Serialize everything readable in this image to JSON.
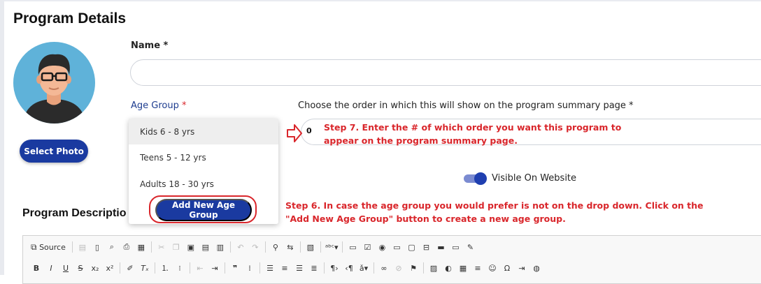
{
  "page": {
    "title": "Program Details"
  },
  "avatar": {
    "icon": "user-avatar-icon"
  },
  "photo": {
    "button_label": "Select Photo"
  },
  "form": {
    "name_label": "Name",
    "name_required": "*",
    "age_group_label": "Age Group",
    "age_group_required": "*",
    "order_label": "Choose the order in which this will show on the program summary page *",
    "order_value": "0",
    "age_group_options": [
      "Kids 6 - 8 yrs",
      "Teens 5 - 12 yrs",
      "Adults 18 - 30 yrs"
    ],
    "add_age_group_label": "Add New Age Group",
    "visible_label": "Visible On Website",
    "visible_on": true,
    "description_label": "Program Descriptio"
  },
  "annotations": {
    "step7_line1": "Step 7. Enter the # of which order you want this program to",
    "step7_line2": "appear on the program summary page.",
    "step6_line1": "Step 6. In case the age group you would prefer is not on the drop down. Click on the",
    "step6_line2": "\"Add New Age Group\" button to create a new age group.",
    "color": "#d9262b"
  },
  "editor": {
    "source_label": "Source",
    "row1_icons": [
      "save-icon",
      "new-page-icon",
      "preview-icon",
      "print-icon",
      "templates-icon",
      "cut-icon",
      "copy-icon",
      "paste-icon",
      "paste-text-icon",
      "paste-word-icon",
      "undo-icon",
      "redo-icon",
      "find-icon",
      "replace-icon",
      "select-all-icon",
      "spellcheck-icon",
      "form-icon",
      "checkbox-icon",
      "radio-icon",
      "textfield-icon",
      "textarea-icon",
      "select-icon",
      "button-icon",
      "image-button-icon",
      "hidden-field-icon"
    ],
    "row2_icons": [
      "bold-icon",
      "italic-icon",
      "underline-icon",
      "strike-icon",
      "subscript-icon",
      "superscript-icon",
      "copy-format-icon",
      "remove-format-icon",
      "numbered-list-icon",
      "bulleted-list-icon",
      "outdent-icon",
      "indent-icon",
      "blockquote-icon",
      "div-icon",
      "align-left-icon",
      "align-center-icon",
      "align-right-icon",
      "justify-icon",
      "ltr-icon",
      "rtl-icon",
      "language-icon",
      "link-icon",
      "unlink-icon",
      "anchor-icon",
      "image-icon",
      "flash-icon",
      "table-icon",
      "horizontal-line-icon",
      "smiley-icon",
      "special-char-icon",
      "page-break-icon",
      "iframe-icon"
    ]
  },
  "colors": {
    "primary_button": "#1a3aa0",
    "label_blue": "#1d3c8f",
    "required_red": "#d9262b"
  }
}
